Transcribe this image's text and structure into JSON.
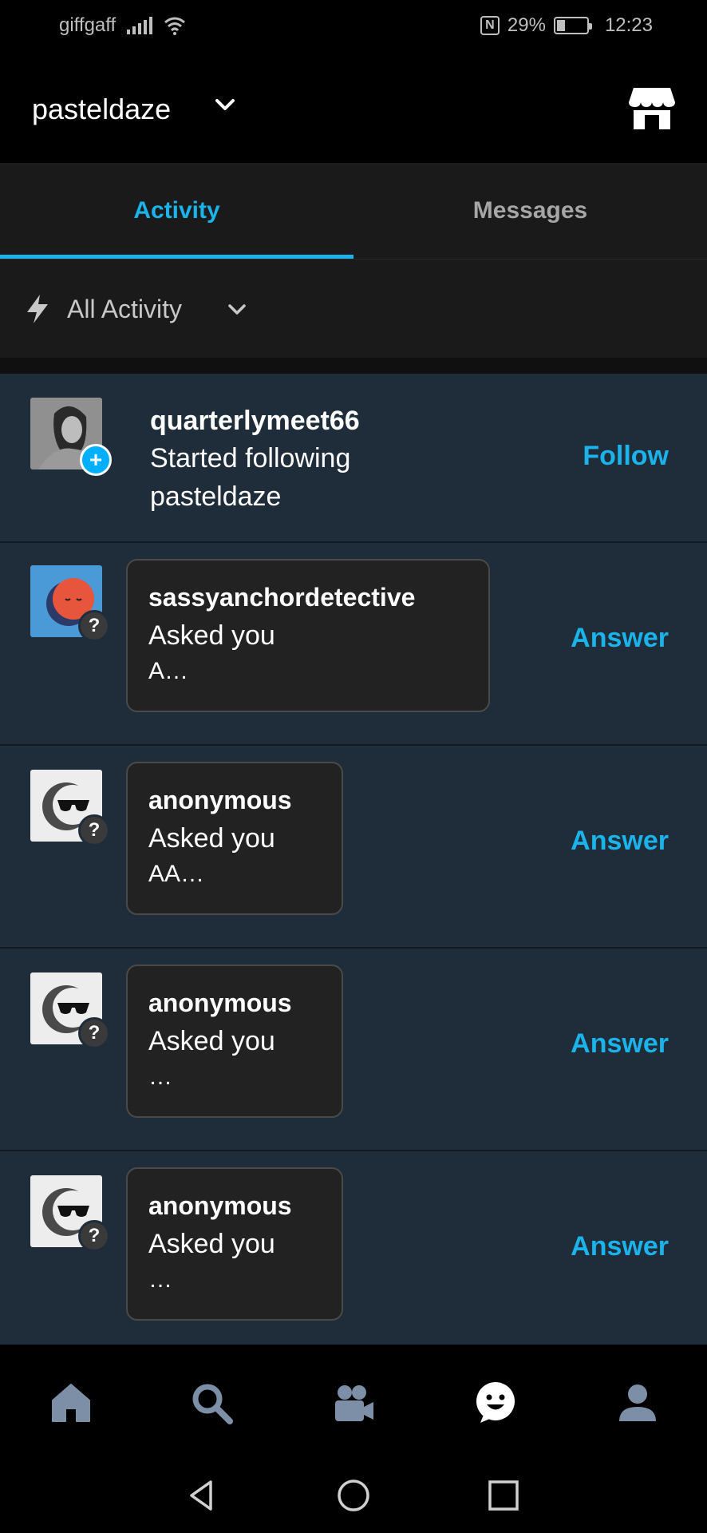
{
  "status_bar": {
    "carrier": "giffgaff",
    "battery": "29%",
    "time": "12:23",
    "battery_level": 0.29
  },
  "header": {
    "blog_name": "pasteldaze",
    "chevron_icon": "chevron-down-icon",
    "shop_icon": "storefront-icon"
  },
  "tabs": [
    {
      "label": "Activity",
      "active": true
    },
    {
      "label": "Messages",
      "active": false
    }
  ],
  "filter": {
    "icon": "lightning-bolt-icon",
    "label": "All Activity"
  },
  "activity": {
    "follow_item": {
      "username": "quarterlymeet66",
      "description": "Started following pasteldaze",
      "action": "Follow"
    },
    "questions": [
      {
        "username": "sassyanchordetective",
        "description": "Asked you",
        "preview": "A…",
        "action": "Answer"
      },
      {
        "username": "anonymous",
        "description": "Asked you",
        "preview": "AA…",
        "action": "Answer"
      },
      {
        "username": "anonymous",
        "description": "Asked you",
        "preview": "…",
        "action": "Answer"
      },
      {
        "username": "anonymous",
        "description": "Asked you",
        "preview": "…",
        "action": "Answer"
      }
    ]
  },
  "colors": {
    "accent": "#1bb3ea",
    "list_bg": "#1f2d3a",
    "tab_bg": "#1a1a1a"
  }
}
